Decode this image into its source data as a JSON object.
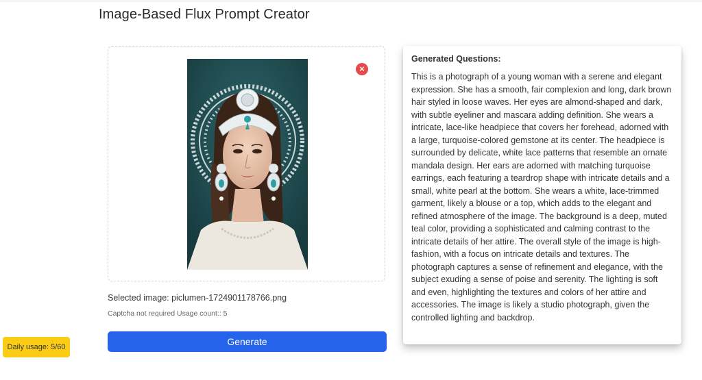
{
  "page": {
    "title": "Image-Based Flux Prompt Creator"
  },
  "upload": {
    "remove_icon": "×",
    "selected_image_text": "Selected image: piclumen-1724901178766.png",
    "captcha_note": "Captcha not required Usage count:: 5",
    "preview_alt": "Uploaded portrait: young woman with lace mandala headpiece and turquoise gemstone on teal background"
  },
  "actions": {
    "generate_label": "Generate"
  },
  "usage_badge": {
    "label": "Daily usage: 5/60"
  },
  "output": {
    "heading": "Generated Questions:",
    "text": "This is a photograph of a young woman with a serene and elegant expression. She has a smooth, fair complexion and long, dark brown hair styled in loose waves. Her eyes are almond-shaped and dark, with subtle eyeliner and mascara adding definition. She wears a intricate, lace-like headpiece that covers her forehead, adorned with a large, turquoise-colored gemstone at its center. The headpiece is surrounded by delicate, white lace patterns that resemble an ornate mandala design. Her ears are adorned with matching turquoise earrings, each featuring a teardrop shape with intricate details and a small, white pearl at the bottom. She wears a white, lace-trimmed garment, likely a blouse or a top, which adds to the elegant and refined atmosphere of the image. The background is a deep, muted teal color, providing a sophisticated and calming contrast to the intricate details of her attire. The overall style of the image is high-fashion, with a focus on intricate details and textures. The photograph captures a sense of refinement and elegance, with the subject exuding a sense of poise and serenity. The lighting is soft and even, highlighting the textures and colors of her attire and accessories. The image is likely a studio photograph, given the controlled lighting and backdrop."
  },
  "colors": {
    "accent_button": "#2563eb",
    "badge": "#facc15",
    "remove_icon": "#e5484d",
    "image_background": "#1f4a4f"
  }
}
